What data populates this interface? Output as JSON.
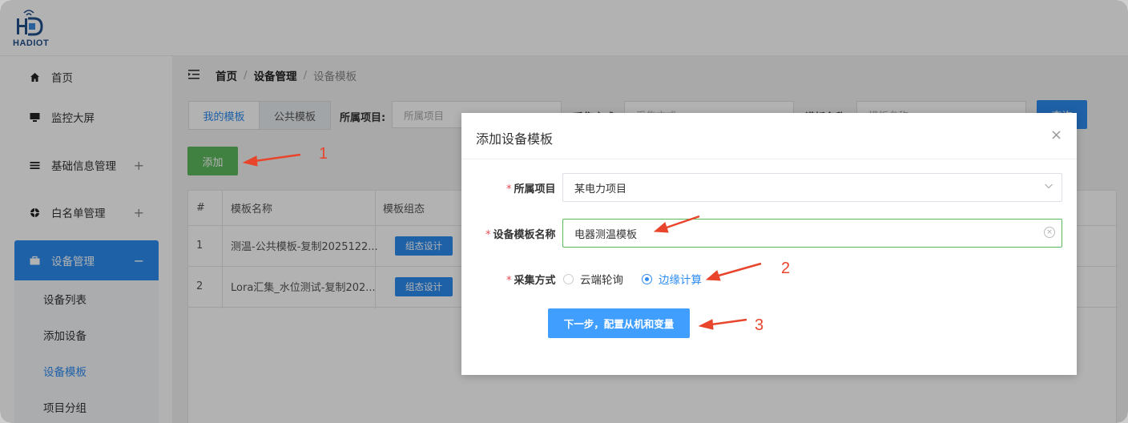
{
  "brand": {
    "logo_text": "HADIOT"
  },
  "sidebar": {
    "items": [
      {
        "label": "首页",
        "icon": "home-icon"
      },
      {
        "label": "监控大屏",
        "icon": "monitor-icon"
      },
      {
        "label": "基础信息管理",
        "icon": "list-icon",
        "expand": "+"
      },
      {
        "label": "白名单管理",
        "icon": "target-icon",
        "expand": "+"
      },
      {
        "label": "设备管理",
        "icon": "briefcase-icon",
        "expand": "−"
      }
    ],
    "sub_items": [
      "设备列表",
      "添加设备",
      "设备模板",
      "项目分组"
    ]
  },
  "breadcrumb": {
    "home": "首页",
    "section": "设备管理",
    "current": "设备模板",
    "sep": "/"
  },
  "tabs": [
    "我的模板",
    "公共模板"
  ],
  "filters": {
    "project_label": "所属项目:",
    "project_placeholder": "所属项目",
    "method_label": "采集方式:",
    "method_placeholder": "采集方式",
    "name_label": "模板名称:",
    "name_placeholder": "模板名称",
    "query_label": "查询"
  },
  "toolbar": {
    "add_label": "添加"
  },
  "table": {
    "headers": [
      "#",
      "模板名称",
      "模板组态"
    ],
    "rows": [
      {
        "index": "1",
        "name": "测温-公共模板-复制2025122...",
        "action": "组态设计"
      },
      {
        "index": "2",
        "name": "Lora汇集_水位测试-复制202...",
        "action": "组态设计"
      }
    ]
  },
  "modal": {
    "title": "添加设备模板",
    "close": "×",
    "project_label": "所属项目",
    "project_value": "某电力项目",
    "name_label": "设备模板名称",
    "name_value": "电器测温模板",
    "method_label": "采集方式",
    "method_options": [
      "云端轮询",
      "边缘计算"
    ],
    "method_selected": "边缘计算",
    "required_mark": "*",
    "next_label": "下一步，配置从机和变量"
  },
  "annotations": [
    "1",
    "2",
    "3"
  ],
  "colors": {
    "primary": "#2d8cf0",
    "success": "#5cb85c",
    "annotation": "#e8452c",
    "required": "#e5484d"
  }
}
